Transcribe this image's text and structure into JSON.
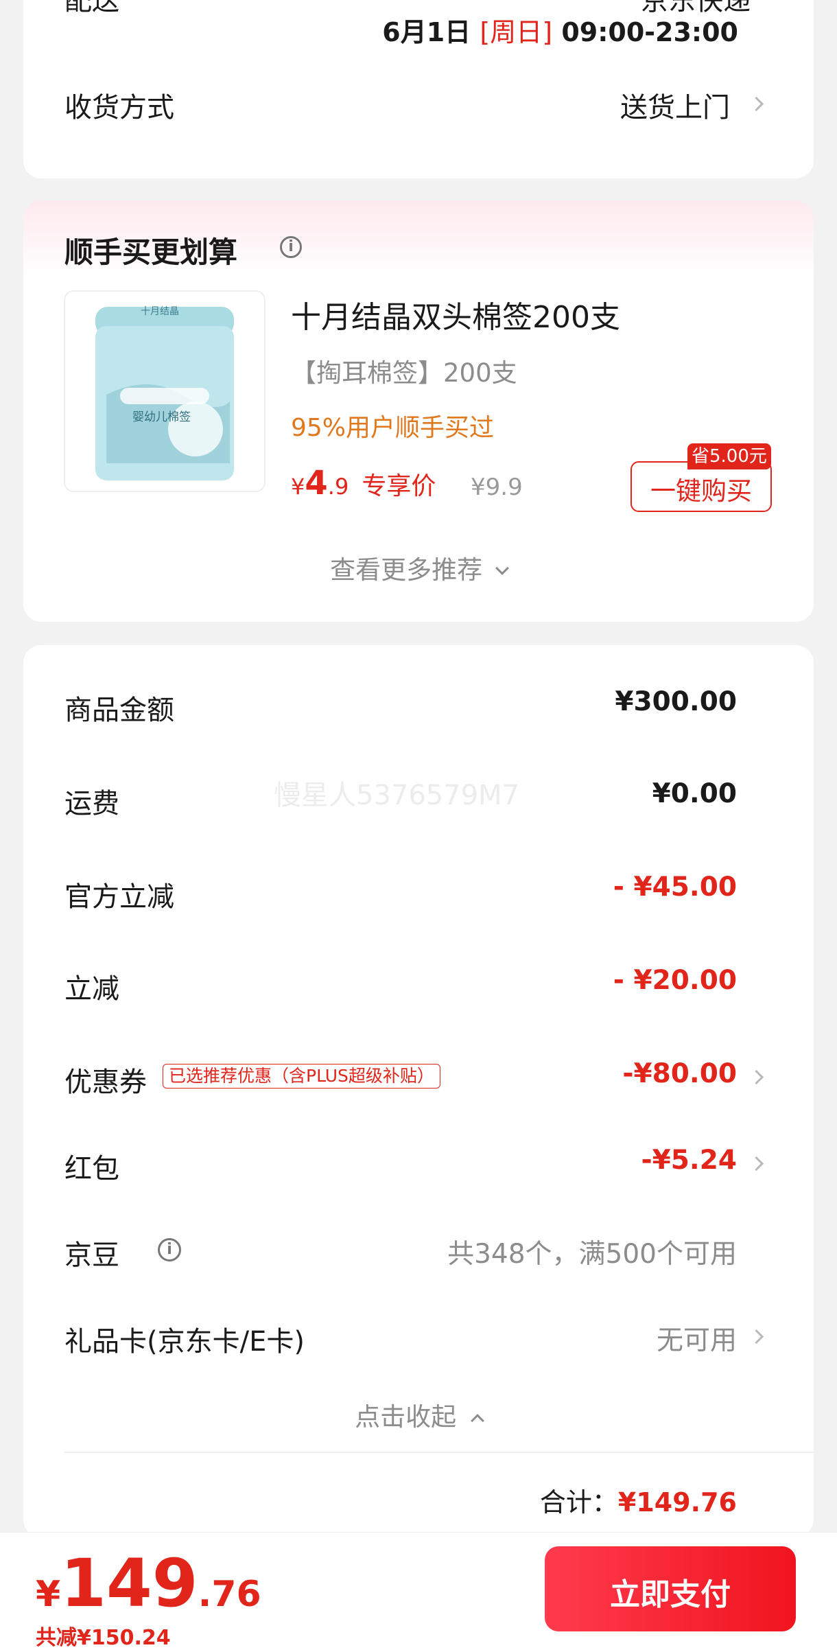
{
  "delivery": {
    "label": "配送",
    "carrier": "京东快递",
    "date": "6月1日",
    "weekday": "[周日]",
    "time": "09:00-23:00",
    "receive_label": "收货方式",
    "receive_value": "送货上门"
  },
  "recommend": {
    "title": "顺手买更划算",
    "product": {
      "brand_text": "十月结晶",
      "package_text": "婴幼儿棉签",
      "name": "十月结晶双头棉签200支",
      "spec": "【掏耳棉签】200支",
      "social_proof": "95%用户顺手买过",
      "currency": "¥",
      "price_int": "4",
      "price_dec": ".9",
      "price_tag": "专享价",
      "original_price": "¥9.9",
      "save_badge": "省5.00元",
      "buy_label": "一键购买"
    },
    "more_label": "查看更多推荐"
  },
  "summary": {
    "watermark": "慢星人5376579M7",
    "rows": [
      {
        "label": "商品金额",
        "value": "¥300.00"
      },
      {
        "label": "运费",
        "value": "¥0.00"
      },
      {
        "label": "官方立减",
        "value": "- ¥45.00"
      },
      {
        "label": "立减",
        "value": "- ¥20.00"
      },
      {
        "label": "优惠券",
        "tag": "已选推荐优惠（含PLUS超级补贴）",
        "value": "-¥80.00"
      },
      {
        "label": "红包",
        "value": "-¥5.24"
      },
      {
        "label": "京豆",
        "value": "共348个，满500个可用"
      },
      {
        "label": "礼品卡(京东卡/E卡)",
        "value": "无可用"
      }
    ],
    "collapse_label": "点击收起",
    "total_label": "合计：",
    "total_value": "¥149.76"
  },
  "bottom_bar": {
    "currency": "¥",
    "amount_int": "149",
    "amount_dec": ".76",
    "saved": "共减¥150.24",
    "pay_label": "立即支付"
  },
  "colors": {
    "accent_red": "#e1251b",
    "orange": "#e0781e",
    "pay_gradient_start": "#ff3b4e",
    "pay_gradient_end": "#f0141e"
  }
}
